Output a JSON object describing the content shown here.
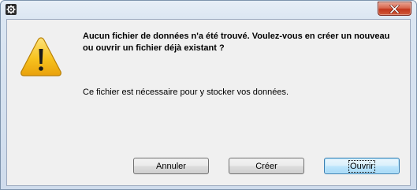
{
  "dialog": {
    "title": "",
    "message": "Aucun fichier de données n'a été trouvé. Voulez-vous en créer un nouveau ou ouvrir un fichier déjà existant ?",
    "detail": "Ce fichier est nécessaire pour y stocker vos données.",
    "icon": "warning-icon",
    "buttons": {
      "cancel_label": "Annuler",
      "create_label": "Créer",
      "open_label": "Ouvrir"
    }
  },
  "titlebar": {
    "app_icon": "gear-icon",
    "close_icon": "close-icon",
    "close_color": "#c2361c"
  },
  "colors": {
    "warning_fill": "#f7c21e",
    "dialog_background": "#f0f0f0"
  }
}
